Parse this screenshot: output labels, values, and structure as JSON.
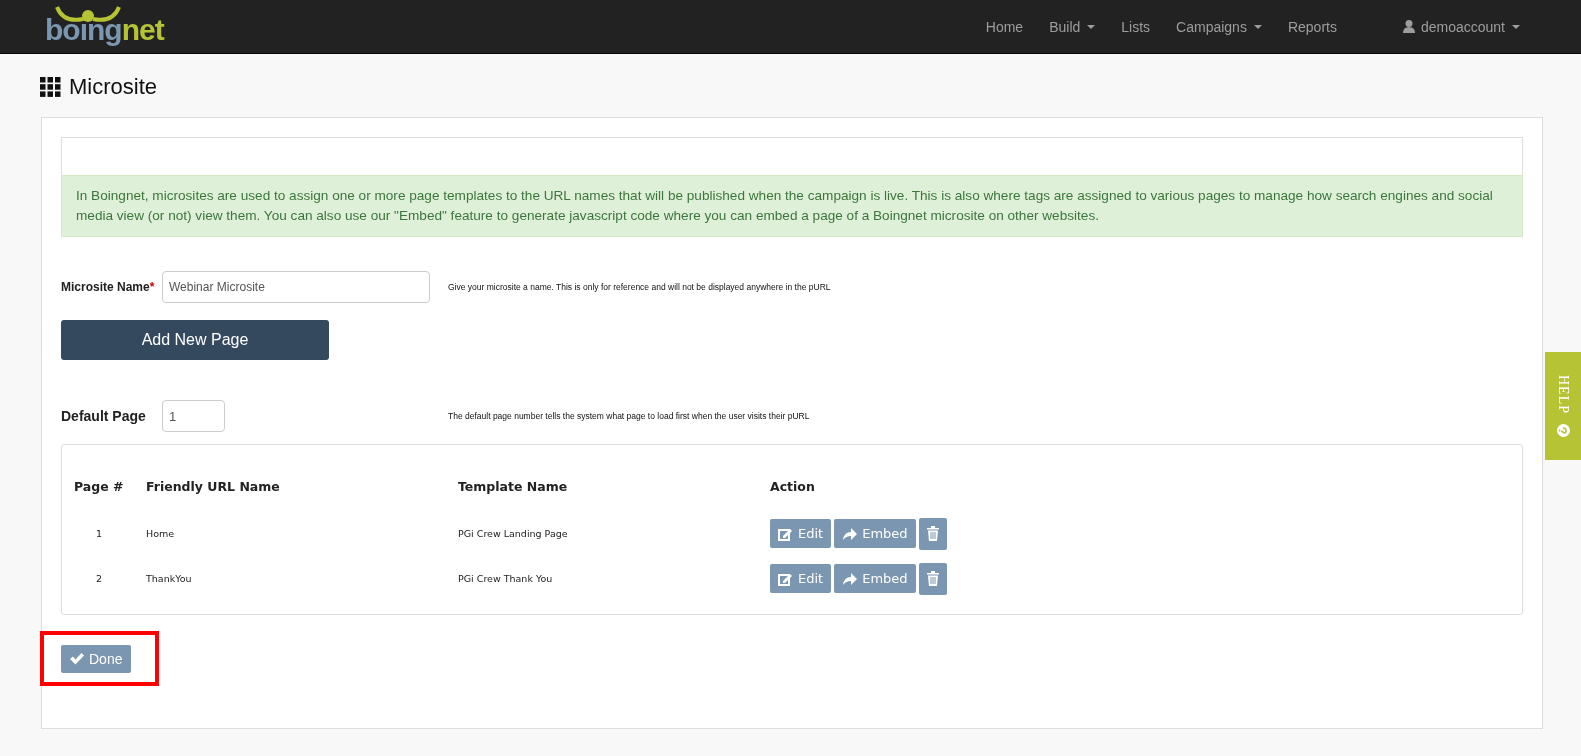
{
  "nav": {
    "logo": [
      "boing",
      "net"
    ],
    "items": [
      {
        "label": "Home",
        "dropdown": false
      },
      {
        "label": "Build",
        "dropdown": true
      },
      {
        "label": "Lists",
        "dropdown": false
      },
      {
        "label": "Campaigns",
        "dropdown": true
      },
      {
        "label": "Reports",
        "dropdown": false
      }
    ],
    "user": {
      "label": "demoaccount",
      "dropdown": true
    }
  },
  "page_title": "Microsite",
  "info_text": "In Boingnet, microsites are used to assign one or more page templates to the URL names that will be published when the campaign is live. This is also where tags are assigned to various pages to manage how search engines and social media view (or not) view them. You can also use our \"Embed\" feature to generate javascript code where you can embed a page of a Boingnet microsite on other websites.",
  "form": {
    "name_label": "Microsite Name",
    "required_mark": "*",
    "name_value": "Webinar Microsite",
    "name_hint": "Give your microsite a name. This is only for reference and will not be displayed anywhere in the pURL",
    "add_button": "Add New Page",
    "default_label": "Default Page",
    "default_value": "1",
    "default_hint": "The default page number tells the system what page to load first when the user visits their pURL"
  },
  "table": {
    "columns": [
      "Page #",
      "Friendly URL Name",
      "Template Name",
      "Action"
    ],
    "rows": [
      {
        "cells": [
          "1",
          "Home",
          "PGi Crew Landing Page"
        ],
        "actions": [
          "Edit",
          "Embed"
        ]
      },
      {
        "cells": [
          "2",
          "ThankYou",
          "PGi Crew Thank You"
        ],
        "actions": [
          "Edit",
          "Embed"
        ]
      }
    ]
  },
  "done_button": "Done",
  "help_tab": "HELP"
}
